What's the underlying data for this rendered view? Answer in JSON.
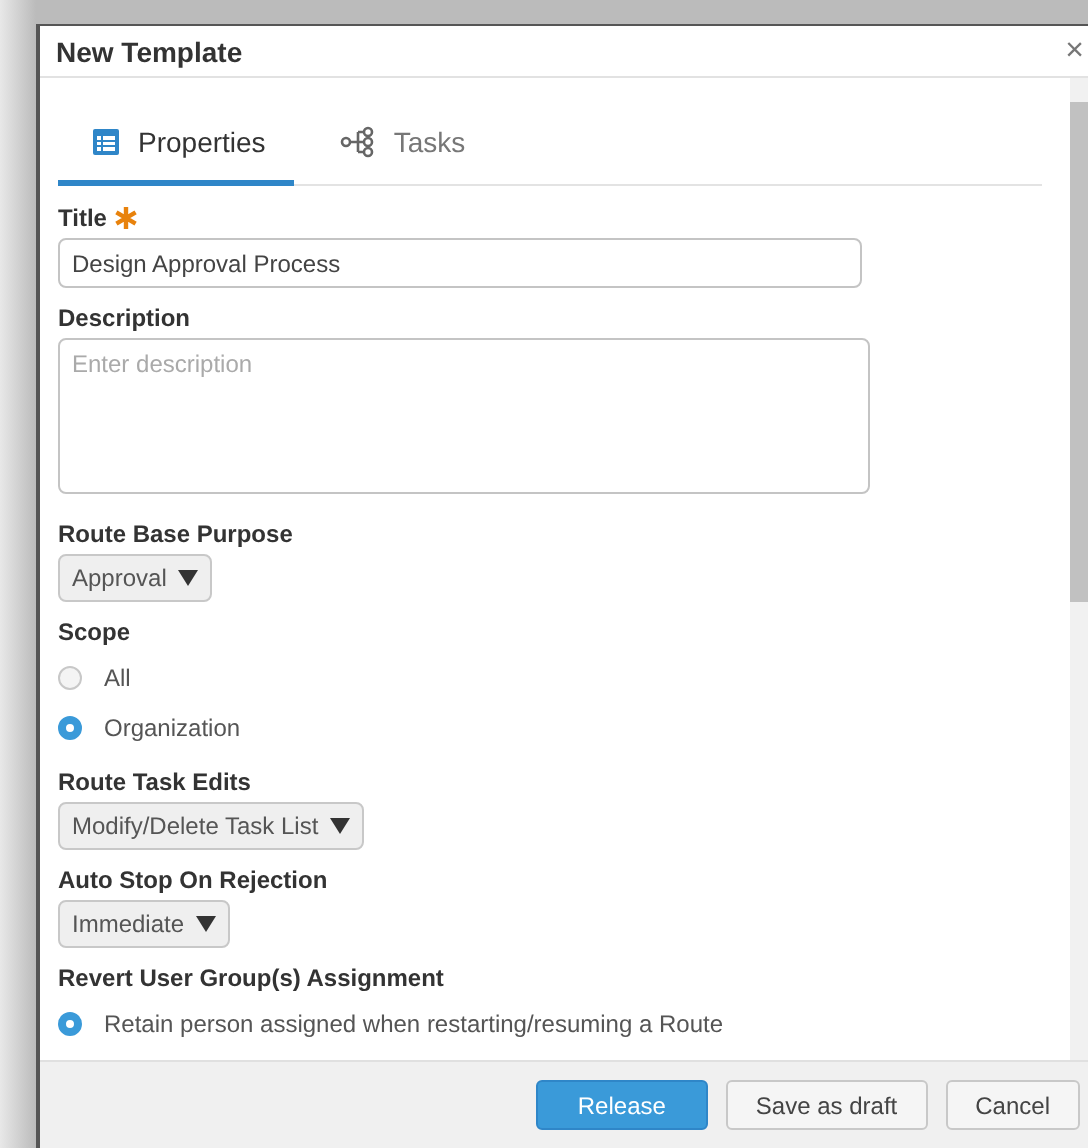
{
  "window": {
    "title": "New Template",
    "close": "×"
  },
  "tabs": [
    {
      "label": "Properties",
      "selected": true
    },
    {
      "label": "Tasks",
      "selected": false
    }
  ],
  "fields": [
    {
      "kind": "text",
      "label": "Title",
      "required": true,
      "value": "Design Approval Process"
    },
    {
      "kind": "textarea",
      "label": "Description",
      "required": false,
      "placeholder": "Enter description"
    },
    {
      "kind": "select",
      "label": "Route Base Purpose",
      "required": false,
      "value": "Approval"
    },
    {
      "kind": "radio",
      "label": "Scope",
      "required": false,
      "options": [
        {
          "label": "All",
          "selected": false
        },
        {
          "label": "Organization",
          "selected": true
        }
      ]
    },
    {
      "kind": "select",
      "label": "Route Task Edits",
      "required": false,
      "value": "Modify/Delete Task List"
    },
    {
      "kind": "select",
      "label": "Auto Stop On Rejection",
      "required": false,
      "value": "Immediate"
    },
    {
      "kind": "radio",
      "label": "Revert User Group(s) Assignment",
      "required": false,
      "options": [
        {
          "label": "Retain person assigned when restarting/resuming a Route",
          "selected": true
        }
      ]
    }
  ],
  "buttons": [
    {
      "label": "Release",
      "kind": "primary"
    },
    {
      "label": "Save as draft",
      "kind": "default"
    },
    {
      "label": "Cancel",
      "kind": "default"
    }
  ]
}
